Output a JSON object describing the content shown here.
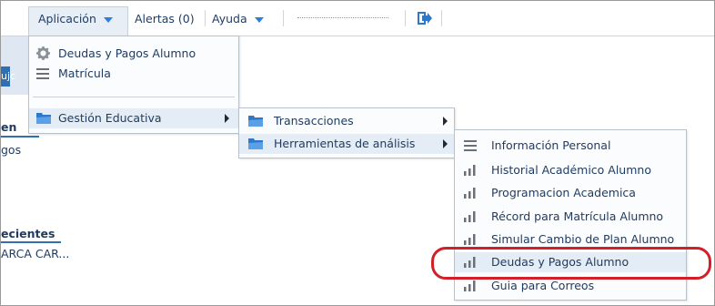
{
  "topbar": {
    "aplicacion": "Aplicación",
    "alertas": "Alertas (0)",
    "ayuda": "Ayuda"
  },
  "background": {
    "band_tab": "ujc",
    "heading1": "en",
    "item1": "gos",
    "heading2": "ecientes",
    "item2": "ARCA CAR..."
  },
  "menu1": {
    "items": [
      {
        "label": "Deudas y Pagos Alumno",
        "icon": "gear-icon"
      },
      {
        "label": "Matrícula",
        "icon": "list-icon"
      },
      {
        "label": "Gestión Educativa",
        "icon": "folder-icon"
      }
    ]
  },
  "menu2": {
    "items": [
      {
        "label": "Transacciones",
        "icon": "folder-icon"
      },
      {
        "label": "Herramientas de análisis",
        "icon": "folder-icon"
      }
    ]
  },
  "menu3": {
    "items": [
      {
        "label": "Información Personal",
        "icon": "list-icon"
      },
      {
        "label": "Historial Académico Alumno",
        "icon": "bar-chart-icon"
      },
      {
        "label": "Programacion Academica",
        "icon": "bar-chart-icon"
      },
      {
        "label": "Récord para Matrícula Alumno",
        "icon": "bar-chart-icon"
      },
      {
        "label": "Simular Cambio de Plan Alumno",
        "icon": "bar-chart-icon"
      },
      {
        "label": "Deudas y Pagos Alumno",
        "icon": "bar-chart-icon"
      },
      {
        "label": "Guia para Correos",
        "icon": "bar-chart-icon"
      }
    ]
  },
  "colors": {
    "accent": "#2a7de1",
    "folder": "#2f78c8",
    "highlight_ring": "#d21f2a"
  }
}
